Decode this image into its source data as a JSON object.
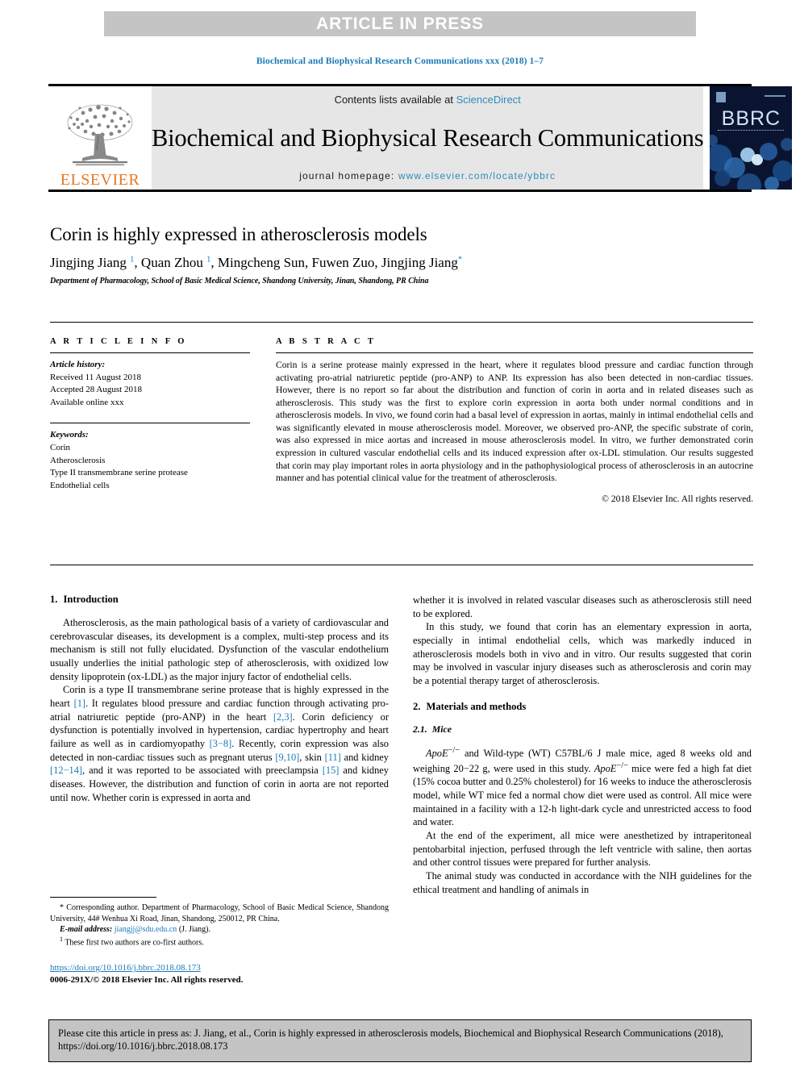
{
  "banner": {
    "text": "ARTICLE IN PRESS"
  },
  "running_head": "Biochemical and Biophysical Research Communications xxx (2018) 1–7",
  "masthead": {
    "publisher": "ELSEVIER",
    "contents_prefix": "Contents lists available at ",
    "contents_link": "ScienceDirect",
    "journal_title": "Biochemical and Biophysical Research Communications",
    "homepage_prefix": "journal homepage: ",
    "homepage_link": "www.elsevier.com/locate/ybbrc",
    "cover_word": "BBRC"
  },
  "title": "Corin is highly expressed in atherosclerosis models",
  "authors_html": "Jingjing Jiang <sup>1</sup>, Quan Zhou <sup>1</sup>, Mingcheng Sun, Fuwen Zuo, Jingjing Jiang<sup>*</sup>",
  "affiliation": "Department of Pharmacology, School of Basic Medical Science, Shandong University, Jinan, Shandong, PR China",
  "article_info": {
    "heading": "A R T I C L E   I N F O",
    "history_label": "Article history:",
    "history": [
      "Received 11 August 2018",
      "Accepted 28 August 2018",
      "Available online xxx"
    ],
    "keywords_label": "Keywords:",
    "keywords": [
      "Corin",
      "Atherosclerosis",
      "Type II transmembrane serine protease",
      "Endothelial cells"
    ]
  },
  "abstract": {
    "heading": "A B S T R A C T",
    "text": "Corin is a serine protease mainly expressed in the heart, where it regulates blood pressure and cardiac function through activating pro-atrial natriuretic peptide (pro-ANP) to ANP. Its expression has also been detected in non-cardiac tissues. However, there is no report so far about the distribution and function of corin in aorta and in related diseases such as atherosclerosis. This study was the first to explore corin expression in aorta both under normal conditions and in atherosclerosis models. In vivo, we found corin had a basal level of expression in aortas, mainly in intimal endothelial cells and was significantly elevated in mouse atherosclerosis model. Moreover, we observed pro-ANP, the specific substrate of corin, was also expressed in mice aortas and increased in mouse atherosclerosis model. In vitro, we further demonstrated corin expression in cultured vascular endothelial cells and its induced expression after ox-LDL stimulation. Our results suggested that corin may play important roles in aorta physiology and in the pathophysiological process of atherosclerosis in an autocrine manner and has potential clinical value for the treatment of atherosclerosis.",
    "copyright": "© 2018 Elsevier Inc. All rights reserved."
  },
  "sections": {
    "intro": {
      "number": "1.",
      "title": "Introduction"
    },
    "methods": {
      "number": "2.",
      "title": "Materials and methods"
    },
    "mice": {
      "number": "2.1.",
      "title": "Mice"
    }
  },
  "body": {
    "left_p1": "Atherosclerosis, as the main pathological basis of a variety of cardiovascular and cerebrovascular diseases, its development is a complex, multi-step process and its mechanism is still not fully elucidated. Dysfunction of the vascular endothelium usually underlies the initial pathologic step of atherosclerosis, with oxidized low density lipoprotein (ox-LDL) as the major injury factor of endothelial cells.",
    "left_p2_html": "Corin is a type II transmembrane serine protease that is highly expressed in the heart <span class=\"ref\">[1]</span>. It regulates blood pressure and cardiac function through activating pro-atrial natriuretic peptide (pro-ANP) in the heart <span class=\"ref\">[2,3]</span>. Corin deficiency or dysfunction is potentially involved in hypertension, cardiac hypertrophy and heart failure as well as in cardiomyopathy <span class=\"ref\">[3&#8722;8]</span>. Recently, corin expression was also detected in non-cardiac tissues such as pregnant uterus <span class=\"ref\">[9,10]</span>, skin <span class=\"ref\">[11]</span> and kidney <span class=\"ref\">[12&#8722;14]</span>, and it was reported to be associated with preeclampsia <span class=\"ref\">[15]</span> and kidney diseases. However, the distribution and function of corin in aorta are not reported until now. Whether corin is expressed in aorta and",
    "right_p1": "whether it is involved in related vascular diseases such as atherosclerosis still need to be explored.",
    "right_p2": "In this study, we found that corin has an elementary expression in aorta, especially in intimal endothelial cells, which was markedly induced in atherosclerosis models both in vivo and in vitro. Our results suggested that corin may be involved in vascular injury diseases such as atherosclerosis and corin may be a potential therapy target of atherosclerosis.",
    "mice_p1_html": "<em class=\"it\">ApoE</em><sup>&#8722;/&#8722;</sup> and Wild-type (WT) C57BL/6 J male mice, aged 8 weeks old and weighing 20&#8722;22 g, were used in this study. <em class=\"it\">ApoE</em><sup>&#8722;/&#8722;</sup> mice were fed a high fat diet (15% cocoa butter and 0.25% cholesterol) for 16 weeks to induce the atherosclerosis model, while WT mice fed a normal chow diet were used as control. All mice were maintained in a facility with a 12-h light-dark cycle and unrestricted access to food and water.",
    "mice_p2": "At the end of the experiment, all mice were anesthetized by intraperitoneal pentobarbital injection, perfused through the left ventricle with saline, then aortas and other control tissues were prepared for further analysis.",
    "mice_p3": "The animal study was conducted in accordance with the NIH guidelines for the ethical treatment and handling of animals in"
  },
  "footnotes": {
    "corresponding": "* Corresponding author. Department of Pharmacology, School of Basic Medical Science, Shandong University, 44# Wenhua Xi Road, Jinan, Shandong, 250012, PR China.",
    "email_label": "E-mail address:",
    "email": "jiangjj@sdu.edu.cn",
    "email_suffix": "(J. Jiang).",
    "co_first_marker": "1",
    "co_first": "These first two authors are co-first authors.",
    "doi": "https://doi.org/10.1016/j.bbrc.2018.08.173",
    "issn_line": "0006-291X/© 2018 Elsevier Inc. All rights reserved."
  },
  "citation_box": {
    "text": "Please cite this article in press as: J. Jiang, et al., Corin is highly expressed in atherosclerosis models, Biochemical and Biophysical Research Communications (2018), https://doi.org/10.1016/j.bbrc.2018.08.173"
  },
  "colors": {
    "link": "#1b7ab5",
    "sciencedirect": "#2b8cbe",
    "elsevier_orange": "#e87722",
    "banner_gray": "#c4c4c4",
    "masthead_gray": "#e6e6e6",
    "cover_navy": "#0a1430"
  }
}
